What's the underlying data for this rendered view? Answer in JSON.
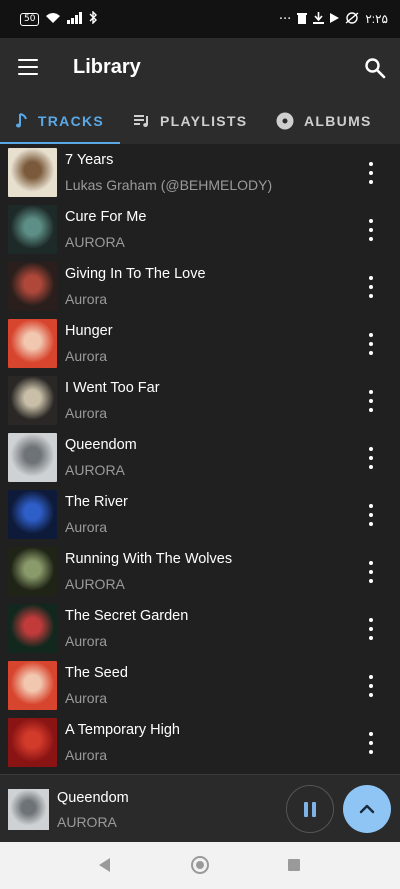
{
  "status_bar": {
    "battery": "50",
    "time": "۲:۲۵",
    "left_icons": [
      "wifi-icon",
      "signal-icon",
      "bluetooth-icon"
    ],
    "right_icons": [
      "more-dots-icon",
      "trash-icon",
      "download-icon",
      "play-icon",
      "alarm-off-icon"
    ]
  },
  "appbar": {
    "title": "Library"
  },
  "tabs": [
    {
      "label": "TRACKS",
      "icon": "music-note-icon",
      "active": true
    },
    {
      "label": "PLAYLISTS",
      "icon": "playlist-icon",
      "active": false
    },
    {
      "label": "ALBUMS",
      "icon": "album-icon",
      "active": false
    }
  ],
  "tracks": [
    {
      "title": "7 Years",
      "artist": "Lukas Graham (@BEHMELODY)",
      "art": [
        "#e8e0cf",
        "#7a5a3a"
      ]
    },
    {
      "title": "Cure For Me",
      "artist": "AURORA",
      "art": [
        "#1e2a28",
        "#5d8f86"
      ]
    },
    {
      "title": "Giving In To The Love",
      "artist": "Aurora",
      "art": [
        "#2a1f1c",
        "#b0483a"
      ]
    },
    {
      "title": "Hunger",
      "artist": "Aurora",
      "art": [
        "#d8452e",
        "#f2c7b0"
      ]
    },
    {
      "title": "I Went Too Far",
      "artist": "Aurora",
      "art": [
        "#2a2826",
        "#c9bfa8"
      ]
    },
    {
      "title": "Queendom",
      "artist": "AURORA",
      "art": [
        "#cfd2d4",
        "#6e7378"
      ]
    },
    {
      "title": "The River",
      "artist": "Aurora",
      "art": [
        "#0e1a3a",
        "#2e5ec8"
      ]
    },
    {
      "title": "Running With The Wolves",
      "artist": "AURORA",
      "art": [
        "#1f2416",
        "#8a9a6a"
      ]
    },
    {
      "title": "The Secret Garden",
      "artist": "Aurora",
      "art": [
        "#12281e",
        "#c23b3b"
      ]
    },
    {
      "title": "The Seed",
      "artist": "Aurora",
      "art": [
        "#d8452e",
        "#f2c7b0"
      ]
    },
    {
      "title": "A Temporary High",
      "artist": "Aurora",
      "art": [
        "#8a1414",
        "#d23a2a"
      ]
    }
  ],
  "now_playing": {
    "title": "Queendom",
    "artist": "AURORA",
    "art": [
      "#cfd2d4",
      "#6e7378"
    ]
  },
  "nav": {
    "icons": [
      "back-icon",
      "home-icon",
      "recents-icon"
    ]
  },
  "colors": {
    "accent": "#5aa9e6",
    "fab": "#8ec5f5",
    "background": "#202020",
    "toolbar": "#2c2c2c"
  }
}
